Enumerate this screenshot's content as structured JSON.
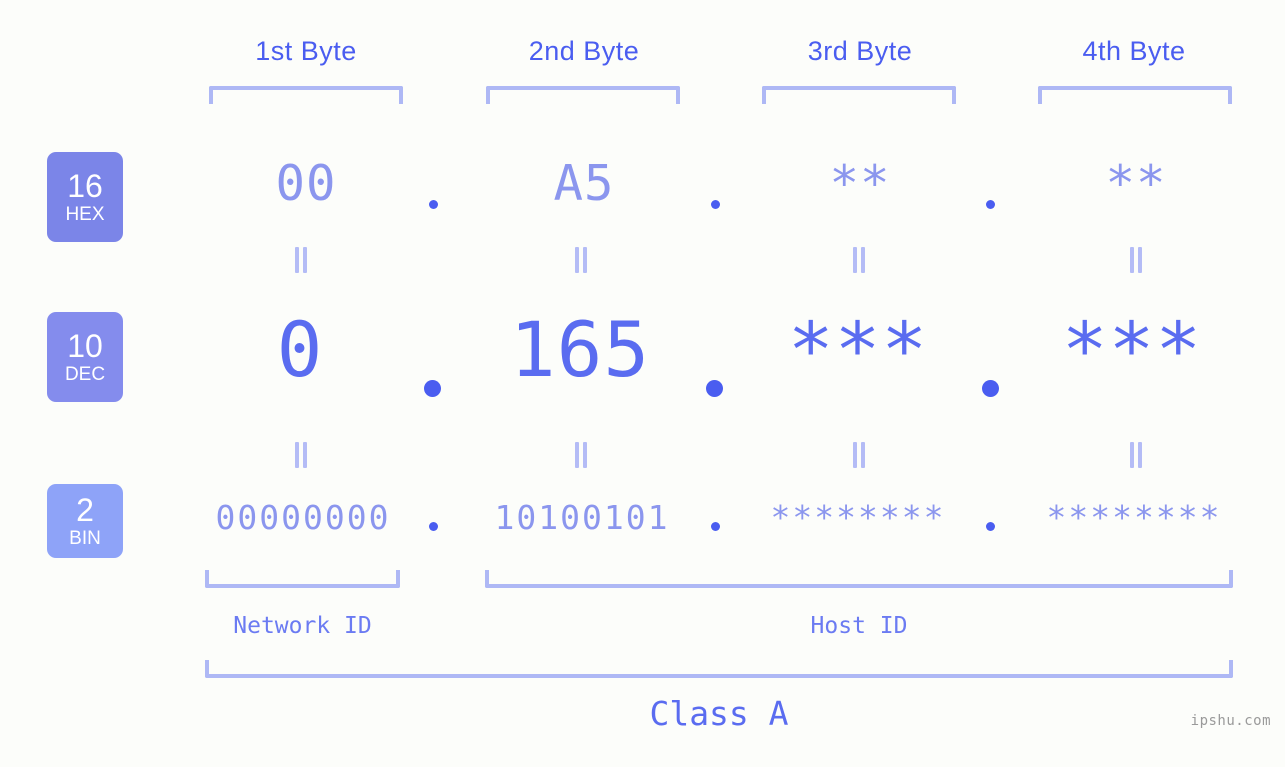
{
  "background": "#fcfdfa",
  "accent": "#4a5df0",
  "bracket_color": "#aeb8f5",
  "bytes": [
    {
      "title": "1st Byte"
    },
    {
      "title": "2nd Byte"
    },
    {
      "title": "3rd Byte"
    },
    {
      "title": "4th Byte"
    }
  ],
  "rows": {
    "hex": {
      "badge_number": "16",
      "badge_label": "HEX",
      "badge_color": "#7b85e8",
      "values": [
        "00",
        "A5",
        "**",
        "**"
      ],
      "separator": "."
    },
    "dec": {
      "badge_number": "10",
      "badge_label": "DEC",
      "badge_color": "#848ced",
      "values": [
        "0",
        "165",
        "***",
        "***"
      ],
      "separator": "."
    },
    "bin": {
      "badge_number": "2",
      "badge_label": "BIN",
      "badge_color": "#8ea3f8",
      "values": [
        "00000000",
        "10100101",
        "********",
        "********"
      ],
      "separator": "."
    }
  },
  "equality_symbol": "=",
  "footer": {
    "network_id": "Network ID",
    "host_id": "Host ID",
    "class": "Class A"
  },
  "watermark": "ipshu.com"
}
